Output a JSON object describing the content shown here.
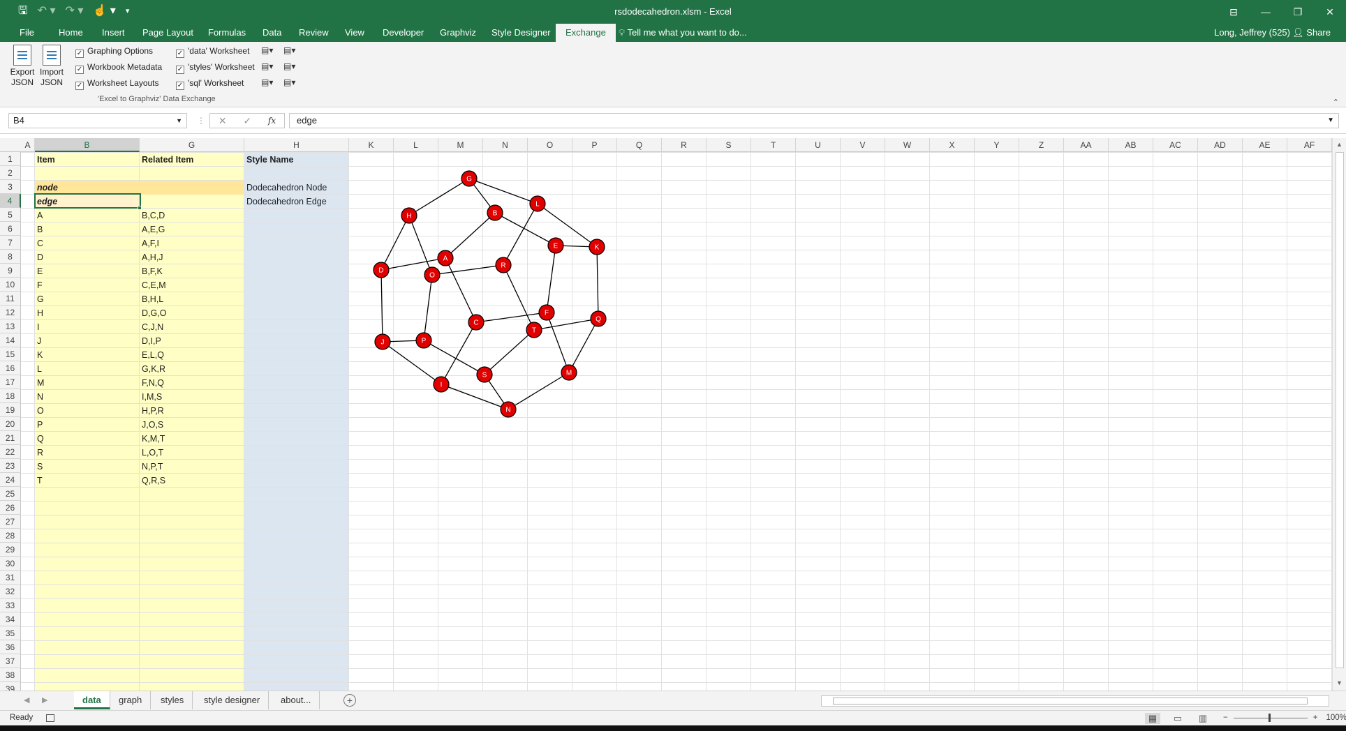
{
  "window": {
    "title": "rsdodecahedron.xlsm - Excel",
    "controls": [
      "⊟",
      "—",
      "❐",
      "✕"
    ]
  },
  "quick_access": {
    "save": "🖫",
    "undo": "↶ ▾",
    "redo": "↷ ▾",
    "touch": "☝ ▾",
    "customize": "▾"
  },
  "ribbon_tabs": [
    {
      "label": "File"
    },
    {
      "label": "Home"
    },
    {
      "label": "Insert"
    },
    {
      "label": "Page Layout"
    },
    {
      "label": "Formulas"
    },
    {
      "label": "Data"
    },
    {
      "label": "Review"
    },
    {
      "label": "View"
    },
    {
      "label": "Developer"
    },
    {
      "label": "Graphviz"
    },
    {
      "label": "Style Designer"
    },
    {
      "label": "Exchange"
    }
  ],
  "tell_me": "Tell me what you want to do...",
  "user": "Long, Jeffrey (525)",
  "share": "Share",
  "ribbon": {
    "export_json": "Export JSON",
    "import_json": "Import JSON",
    "options": [
      {
        "label": "Graphing Options",
        "checked": true
      },
      {
        "label": "Workbook Metadata",
        "checked": true
      },
      {
        "label": "Worksheet Layouts",
        "checked": true
      }
    ],
    "worksheets": [
      {
        "label": "'data' Worksheet",
        "checked": true
      },
      {
        "label": "'styles' Worksheet",
        "checked": true
      },
      {
        "label": "'sql' Worksheet",
        "checked": true
      }
    ],
    "group_label": "'Excel to Graphviz' Data Exchange"
  },
  "formula_bar": {
    "name_box": "B4",
    "cancel": "✕",
    "enter": "✓",
    "fx": "fx",
    "value": "edge"
  },
  "columns": [
    "A",
    "B",
    "G",
    "H",
    "K",
    "L",
    "M",
    "N",
    "O",
    "P",
    "Q",
    "R",
    "S",
    "T",
    "U",
    "V",
    "W",
    "X",
    "Y",
    "Z",
    "AA",
    "AB",
    "AC",
    "AD",
    "AE",
    "AF"
  ],
  "rows": [
    "1",
    "2",
    "3",
    "4",
    "5",
    "6",
    "7",
    "8",
    "9",
    "10",
    "11",
    "12",
    "13",
    "14",
    "15",
    "16",
    "17",
    "18",
    "19",
    "20",
    "21",
    "22",
    "23",
    "24",
    "25",
    "26",
    "27",
    "28",
    "29",
    "30",
    "31",
    "32",
    "33",
    "34",
    "35",
    "36",
    "37",
    "38",
    "39"
  ],
  "table": {
    "headers": {
      "item": "Item",
      "related": "Related Item",
      "style": "Style Name"
    },
    "style_rows": [
      {
        "item": "node",
        "style": "Dodecahedron Node"
      },
      {
        "item": "edge",
        "style": "Dodecahedron Edge"
      }
    ],
    "data_rows": [
      {
        "item": "A",
        "related": "B,C,D"
      },
      {
        "item": "B",
        "related": "A,E,G"
      },
      {
        "item": "C",
        "related": "A,F,I"
      },
      {
        "item": "D",
        "related": "A,H,J"
      },
      {
        "item": "E",
        "related": "B,F,K"
      },
      {
        "item": "F",
        "related": "C,E,M"
      },
      {
        "item": "G",
        "related": "B,H,L"
      },
      {
        "item": "H",
        "related": "D,G,O"
      },
      {
        "item": "I",
        "related": "C,J,N"
      },
      {
        "item": "J",
        "related": "D,I,P"
      },
      {
        "item": "K",
        "related": "E,L,Q"
      },
      {
        "item": "L",
        "related": "G,K,R"
      },
      {
        "item": "M",
        "related": "F,N,Q"
      },
      {
        "item": "N",
        "related": "I,M,S"
      },
      {
        "item": "O",
        "related": "H,P,R"
      },
      {
        "item": "P",
        "related": "J,O,S"
      },
      {
        "item": "Q",
        "related": "K,M,T"
      },
      {
        "item": "R",
        "related": "L,O,T"
      },
      {
        "item": "S",
        "related": "N,P,T"
      },
      {
        "item": "T",
        "related": "Q,R,S"
      }
    ]
  },
  "graph": {
    "node_color": "#e00000",
    "nodes": [
      "A",
      "B",
      "C",
      "D",
      "E",
      "F",
      "G",
      "H",
      "I",
      "J",
      "K",
      "L",
      "M",
      "N",
      "O",
      "P",
      "Q",
      "R",
      "S",
      "T"
    ],
    "edges": [
      [
        "A",
        "B"
      ],
      [
        "A",
        "C"
      ],
      [
        "A",
        "D"
      ],
      [
        "B",
        "E"
      ],
      [
        "B",
        "G"
      ],
      [
        "C",
        "F"
      ],
      [
        "C",
        "I"
      ],
      [
        "D",
        "H"
      ],
      [
        "D",
        "J"
      ],
      [
        "E",
        "F"
      ],
      [
        "E",
        "K"
      ],
      [
        "F",
        "M"
      ],
      [
        "G",
        "H"
      ],
      [
        "G",
        "L"
      ],
      [
        "H",
        "O"
      ],
      [
        "I",
        "J"
      ],
      [
        "I",
        "N"
      ],
      [
        "J",
        "P"
      ],
      [
        "K",
        "L"
      ],
      [
        "K",
        "Q"
      ],
      [
        "L",
        "R"
      ],
      [
        "M",
        "N"
      ],
      [
        "M",
        "Q"
      ],
      [
        "N",
        "S"
      ],
      [
        "O",
        "P"
      ],
      [
        "O",
        "R"
      ],
      [
        "P",
        "S"
      ],
      [
        "Q",
        "T"
      ],
      [
        "R",
        "T"
      ],
      [
        "S",
        "T"
      ]
    ]
  },
  "sheets": [
    {
      "label": "data",
      "active": true
    },
    {
      "label": "graph"
    },
    {
      "label": "styles"
    },
    {
      "label": "style designer"
    },
    {
      "label": "about..."
    }
  ],
  "status": {
    "ready": "Ready",
    "zoom": "100%",
    "zoom_minus": "−",
    "zoom_plus": "+"
  },
  "colors": {
    "excel_green": "#217346",
    "item_fill": "#ffffc5",
    "style_fill": "#dce6f1",
    "header_fill": "#fff2cc",
    "style_row_fill": "#ffe699"
  }
}
